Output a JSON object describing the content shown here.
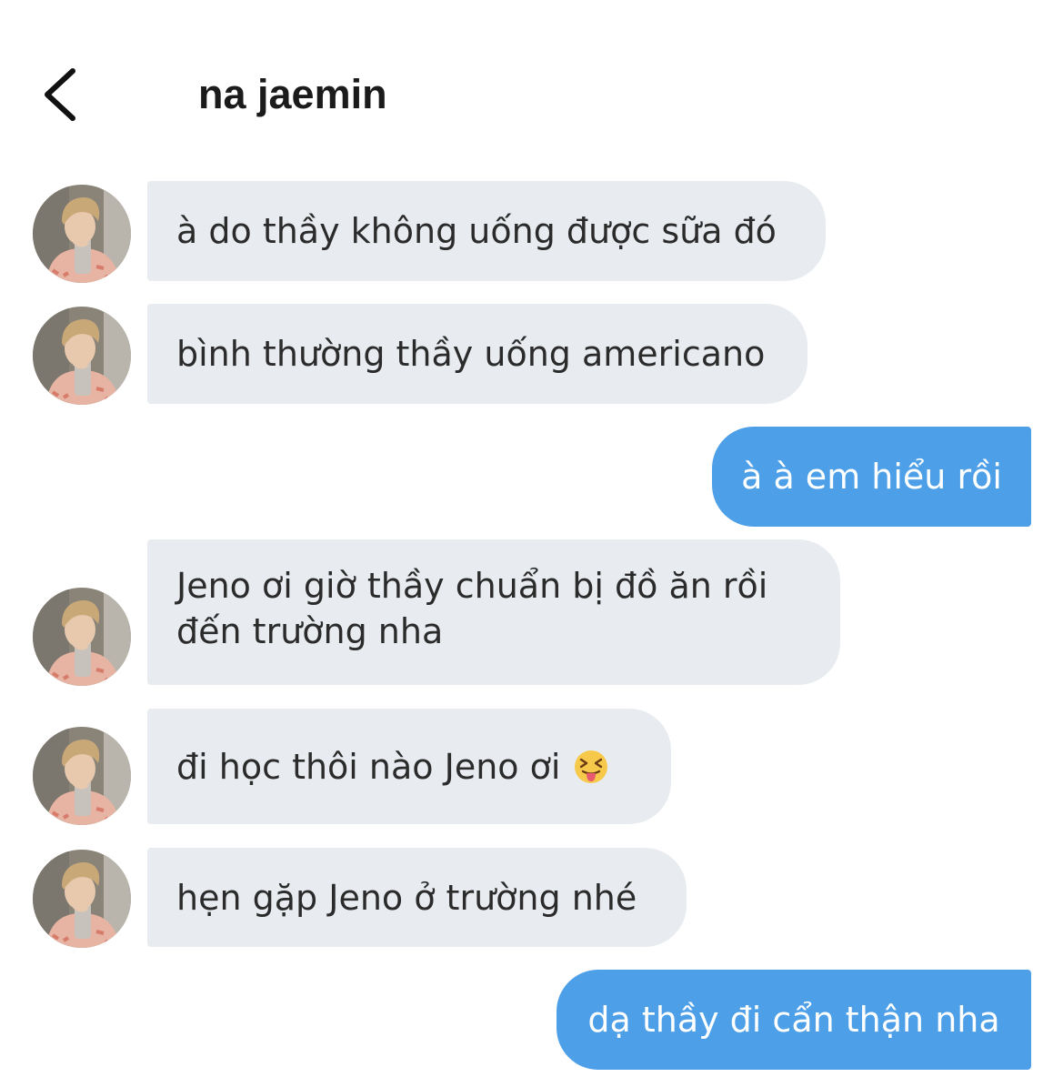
{
  "header": {
    "title": "na jaemin"
  },
  "messages": [
    {
      "from": "them",
      "text": "à do thầy không uống được sữa đó"
    },
    {
      "from": "them",
      "text": "bình thường thầy uống americano"
    },
    {
      "from": "me",
      "text": "à à em hiểu rồi"
    },
    {
      "from": "them",
      "lines": [
        "Jeno ơi giờ thầy chuẩn bị đồ ăn rồi",
        "đến trường nha"
      ]
    },
    {
      "from": "them",
      "text": "đi học thôi nào Jeno ơi",
      "emoji": "squinting-tongue-face"
    },
    {
      "from": "them",
      "text": "hẹn gặp Jeno ở trường nhé"
    },
    {
      "from": "me",
      "text": "dạ thầy đi cẩn thận nha"
    }
  ],
  "colors": {
    "incoming_bubble": "#e8ecf0",
    "outgoing_bubble": "#4d9fe8",
    "text": "#2b2b2b"
  }
}
